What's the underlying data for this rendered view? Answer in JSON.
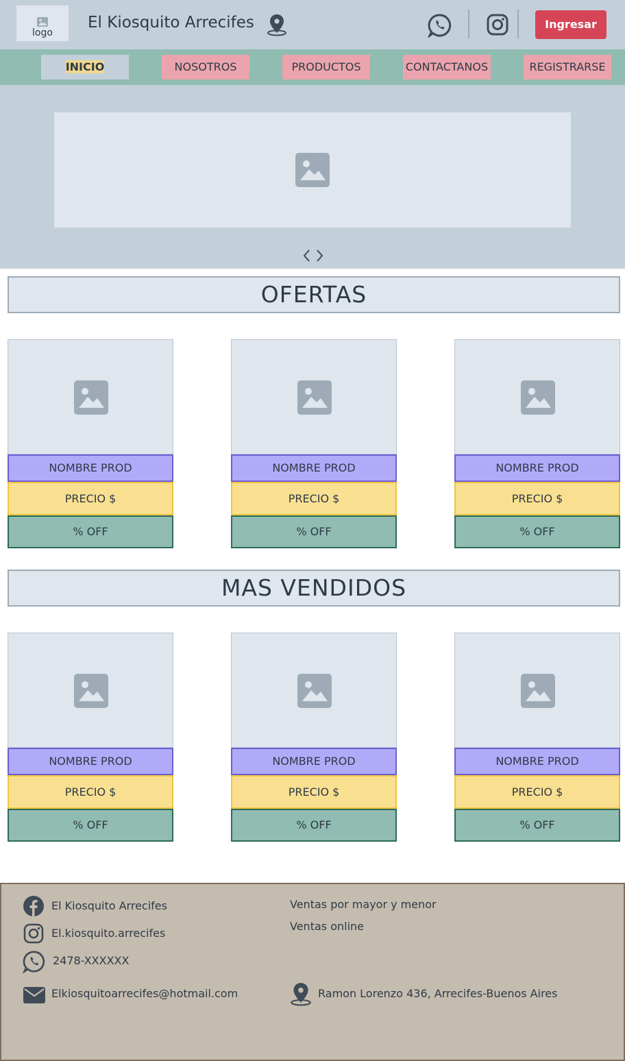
{
  "header": {
    "logo_label": "logo",
    "brand": "El Kiosquito Arrecifes",
    "login_label": "Ingresar"
  },
  "nav": {
    "items": [
      {
        "label": "INICIO",
        "active": true
      },
      {
        "label": "NOSOTROS"
      },
      {
        "label": "PRODUCTOS"
      },
      {
        "label": "CONTACTANOS"
      },
      {
        "label": "REGISTRARSE"
      }
    ]
  },
  "hero": {
    "prev_arrow": "‹",
    "next_arrow": "›"
  },
  "sections": {
    "offers": {
      "title": "OFERTAS",
      "cards": [
        {
          "name": "NOMBRE PROD",
          "price": "PRECIO $",
          "off": "% OFF"
        },
        {
          "name": "NOMBRE PROD",
          "price": "PRECIO $",
          "off": "% OFF"
        },
        {
          "name": "NOMBRE PROD",
          "price": "PRECIO $",
          "off": "% OFF"
        }
      ]
    },
    "best_sellers": {
      "title": "MAS VENDIDOS",
      "cards": [
        {
          "name": "NOMBRE PROD",
          "price": "PRECIO $",
          "off": "% OFF"
        },
        {
          "name": "NOMBRE PROD",
          "price": "PRECIO $",
          "off": "% OFF"
        },
        {
          "name": "NOMBRE PROD",
          "price": "PRECIO $",
          "off": "% OFF"
        }
      ]
    }
  },
  "footer": {
    "facebook": "El Kiosquito Arrecifes",
    "instagram": "El.kiosquito.arrecifes",
    "whatsapp": "2478-XXXXXX",
    "email": "Elkiosquitoarrecifes@hotmail.com",
    "sales_1": "Ventas por mayor y menor",
    "sales_2": "Ventas online",
    "address": "Ramon Lorenzo 436, Arrecifes-Buenos Aires"
  },
  "colors": {
    "header_bg": "#c4d0d9",
    "nav_bg": "#90bcb1",
    "nav_item_bg": "#eba4ad",
    "login_bg": "#d54457",
    "name_bg": "#b1aaf9",
    "price_bg": "#f9e091",
    "off_bg": "#90bcb1",
    "footer_bg": "#c5bcb0"
  },
  "icons": [
    "image-icon",
    "location-pin-icon",
    "whatsapp-icon",
    "instagram-icon",
    "facebook-icon",
    "email-icon",
    "chevron-left-icon",
    "chevron-right-icon"
  ]
}
